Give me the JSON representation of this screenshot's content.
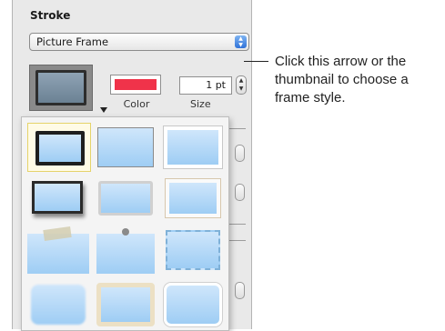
{
  "inspector": {
    "section_title": "Stroke",
    "stroke_type": "Picture Frame",
    "color_label": "Color",
    "size_value": "1 pt",
    "size_label": "Size",
    "stroke_color": "#f0334a"
  },
  "frame_palette": {
    "styles": [
      {
        "name": "frame-style-rough-black",
        "selected": true
      },
      {
        "name": "frame-style-thin-gray",
        "selected": false
      },
      {
        "name": "frame-style-white-border",
        "selected": false
      },
      {
        "name": "frame-style-drop-shadow",
        "selected": false
      },
      {
        "name": "frame-style-photo-corners-silver",
        "selected": false
      },
      {
        "name": "frame-style-photo-corners-beige",
        "selected": false
      },
      {
        "name": "frame-style-tape",
        "selected": false
      },
      {
        "name": "frame-style-pushpin",
        "selected": false
      },
      {
        "name": "frame-style-torn-edge",
        "selected": false
      },
      {
        "name": "frame-style-soft-vignette",
        "selected": false
      },
      {
        "name": "frame-style-cream-mat",
        "selected": false
      },
      {
        "name": "frame-style-rounded-white",
        "selected": false
      }
    ]
  },
  "callout": {
    "text": "Click this arrow or the thumbnail to choose a frame style."
  }
}
